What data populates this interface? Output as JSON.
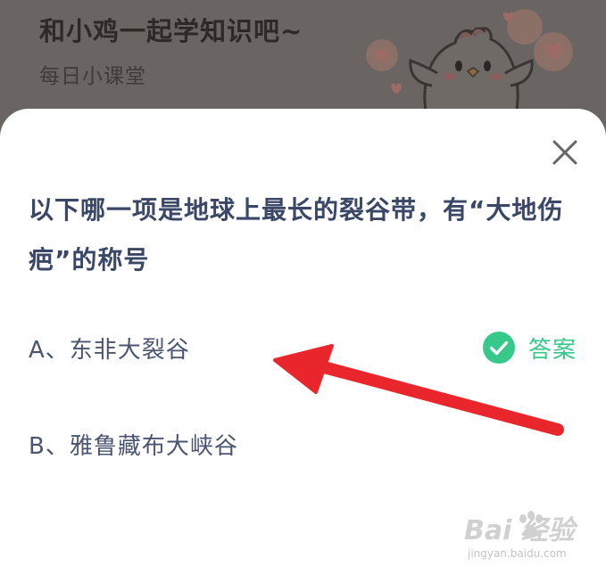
{
  "header": {
    "title": "和小鸡一起学知识吧~",
    "subtitle": "每日小课堂"
  },
  "quiz": {
    "question": "以下哪一项是地球上最长的裂谷带，有“大地伤疤”的称号",
    "options": [
      {
        "label": "A、东非大裂谷",
        "is_answer": true
      },
      {
        "label": "B、雅鲁藏布大峡谷",
        "is_answer": false
      }
    ],
    "answer_label": "答案"
  },
  "watermark": {
    "brand": "Bai 经验",
    "url": "jingyan.baidu.com"
  },
  "colors": {
    "question_text": "#3a4766",
    "option_text": "#4a5570",
    "answer_green": "#36c98a",
    "arrow_red": "#e8262c",
    "overlay": "#5e5b58"
  },
  "icons": {
    "close": "close-icon",
    "check": "check-circle-icon",
    "arrow": "red-arrow-annotation"
  }
}
